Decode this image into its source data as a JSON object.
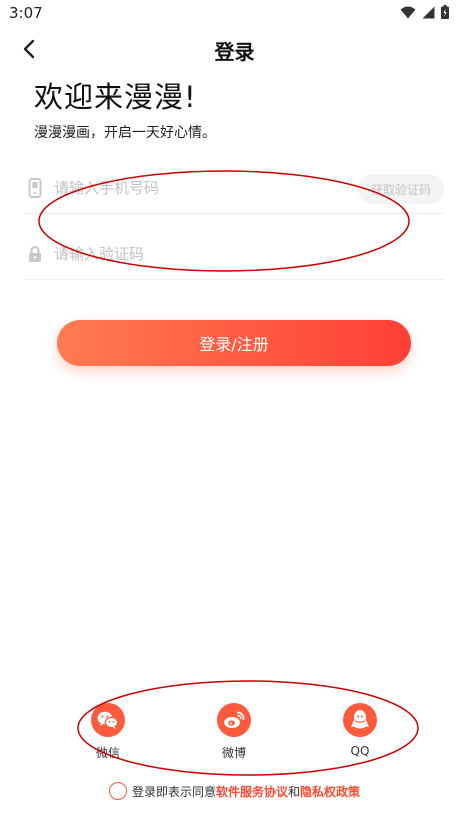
{
  "status_bar": {
    "time": "3:07"
  },
  "nav": {
    "title": "登录",
    "back_icon": "chevron-left-icon"
  },
  "welcome": {
    "title": "欢迎来漫漫!",
    "subtitle": "漫漫漫画，开启一天好心情。"
  },
  "form": {
    "phone": {
      "placeholder": "请输入手机号码",
      "value": ""
    },
    "code": {
      "placeholder": "请输入验证码",
      "value": ""
    },
    "get_code_label": "获取验证码"
  },
  "login_button": {
    "label": "登录/注册"
  },
  "social": [
    {
      "label": "微信",
      "icon": "wechat-icon"
    },
    {
      "label": "微博",
      "icon": "weibo-icon"
    },
    {
      "label": "QQ",
      "icon": "qq-icon"
    }
  ],
  "agreement": {
    "prefix": "登录即表示同意",
    "service_link": "软件服务协议",
    "and": "和",
    "privacy_link": "隐私权政策",
    "checked": false
  },
  "colors": {
    "accent": "#ff5a3c",
    "gradient_start": "#ff7b50",
    "gradient_end": "#ff3f36",
    "annotation": "#cc0000"
  }
}
